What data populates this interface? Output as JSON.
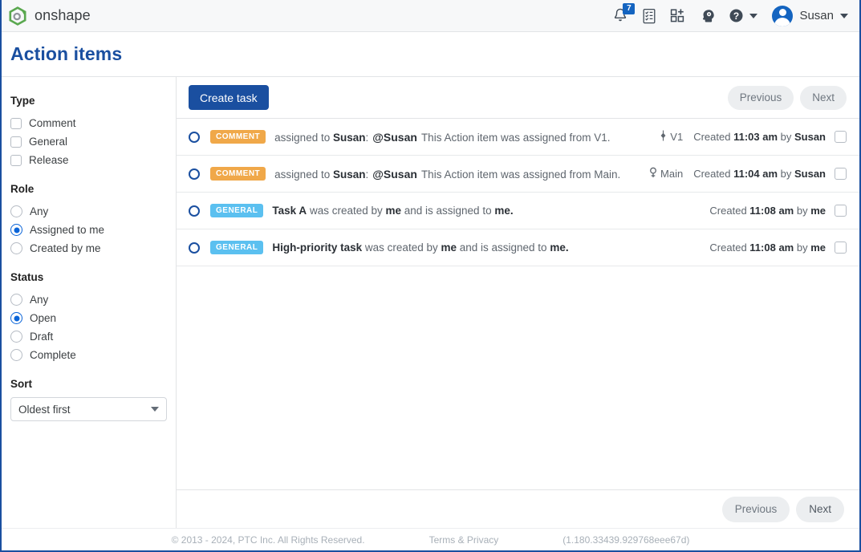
{
  "topbar": {
    "brand_name": "onshape",
    "notifications_badge": "7",
    "user_name": "Susan",
    "icons": {
      "bell": "bell-icon",
      "tasks": "tasks-list-icon",
      "apps": "app-grid-add-icon",
      "learning": "learning-center-icon",
      "help": "help-icon"
    }
  },
  "page": {
    "title": "Action items"
  },
  "sidebar": {
    "groups": [
      {
        "title": "Type",
        "control": "checkbox",
        "options": [
          {
            "label": "Comment",
            "checked": false
          },
          {
            "label": "General",
            "checked": false
          },
          {
            "label": "Release",
            "checked": false
          }
        ]
      },
      {
        "title": "Role",
        "control": "radio",
        "options": [
          {
            "label": "Any",
            "checked": false
          },
          {
            "label": "Assigned to me",
            "checked": true
          },
          {
            "label": "Created by me",
            "checked": false
          }
        ]
      },
      {
        "title": "Status",
        "control": "radio",
        "options": [
          {
            "label": "Any",
            "checked": false
          },
          {
            "label": "Open",
            "checked": true
          },
          {
            "label": "Draft",
            "checked": false
          },
          {
            "label": "Complete",
            "checked": false
          }
        ]
      }
    ],
    "sort": {
      "title": "Sort",
      "value": "Oldest first"
    }
  },
  "toolbar": {
    "create_task_label": "Create task",
    "previous_label": "Previous",
    "next_label": "Next"
  },
  "tasks": [
    {
      "status": "open",
      "badge": "COMMENT",
      "badge_type": "comment",
      "text_prefix": "assigned to ",
      "assignee": "Susan",
      "colon": ":",
      "mention": "@Susan",
      "body": "This Action item was assigned from V1.",
      "source_icon": "version-icon",
      "source": "V1",
      "created_prefix": "Created ",
      "created_time": "11:03 am",
      "created_by_prefix": " by ",
      "created_by": "Susan"
    },
    {
      "status": "open",
      "badge": "COMMENT",
      "badge_type": "comment",
      "text_prefix": "assigned to ",
      "assignee": "Susan",
      "colon": ":",
      "mention": "@Susan",
      "body": "This Action item was assigned from Main.",
      "source_icon": "workspace-icon",
      "source": "Main",
      "created_prefix": "Created ",
      "created_time": "11:04 am",
      "created_by_prefix": " by ",
      "created_by": "Susan"
    },
    {
      "status": "open",
      "badge": "GENERAL",
      "badge_type": "general",
      "title": "Task A",
      "mid": " was created by ",
      "creator": "me",
      "mid2": " and is assigned to ",
      "assignee2": "me",
      "period": ".",
      "source_icon": "",
      "source": "",
      "created_prefix": "Created ",
      "created_time": "11:08 am",
      "created_by_prefix": " by ",
      "created_by": "me"
    },
    {
      "status": "open",
      "badge": "GENERAL",
      "badge_type": "general",
      "title": "High-priority task",
      "mid": " was created by ",
      "creator": "me",
      "mid2": " and is assigned to ",
      "assignee2": "me",
      "period": ".",
      "source_icon": "",
      "source": "",
      "created_prefix": "Created ",
      "created_time": "11:08 am",
      "created_by_prefix": " by ",
      "created_by": "me"
    }
  ],
  "bottom_pager": {
    "previous_label": "Previous",
    "next_label": "Next"
  },
  "footer": {
    "copyright": "© 2013 - 2024, PTC Inc. All Rights Reserved.",
    "terms": "Terms & Privacy",
    "version": "(1.180.33439.929768eee67d)"
  },
  "colors": {
    "brand_blue": "#1a4fa0",
    "accent_blue": "#0a64d8",
    "comment_badge": "#f0a849",
    "general_badge": "#5bc0f0",
    "logo_green": "#5aa84f"
  }
}
